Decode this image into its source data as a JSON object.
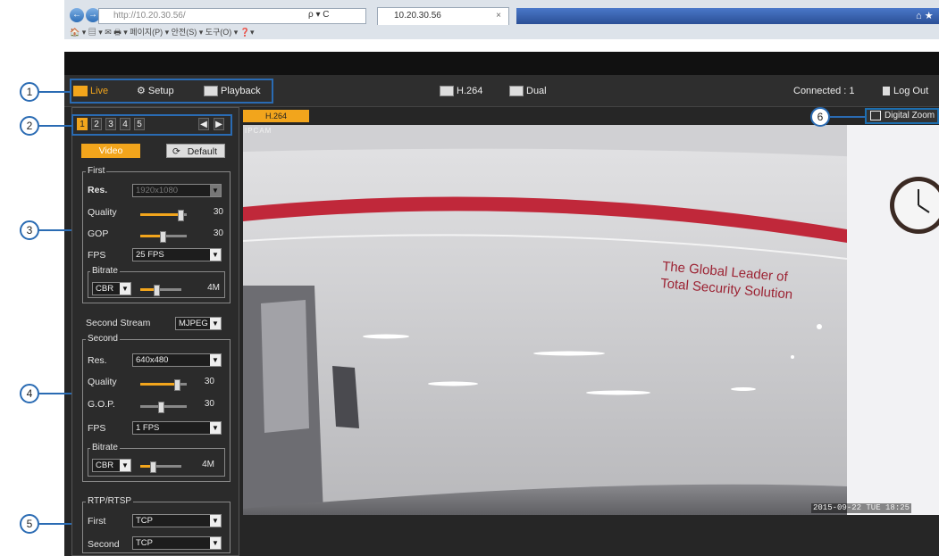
{
  "browser": {
    "back_icon": "back-arrow-icon",
    "forward_icon": "forward-arrow-icon",
    "address": "http://10.20.30.56/",
    "address_tools": "ρ ▾ C",
    "tab_title": "10.20.30.56",
    "tab_close": "×",
    "right_icons": "⌂ ★",
    "commands": "🏠 ▾  ▤ ▾ ✉  🖶 ▾  페이지(P) ▾  안전(S) ▾  도구(O) ▾  ❓▾"
  },
  "topbar": {
    "live": "Live",
    "setup": "Setup",
    "playback": "Playback",
    "codec1": "H.264",
    "codec2": "Dual",
    "connected": "Connected : 1",
    "logout": "Log Out"
  },
  "channels": {
    "items": [
      "1",
      "2",
      "3",
      "4",
      "5"
    ],
    "prev": "◀",
    "next": "▶"
  },
  "video_settings": {
    "video_btn": "Video",
    "default_btn": "Default",
    "first": {
      "legend": "First",
      "res_label": "Res.",
      "res_value": "1920x1080",
      "quality_label": "Quality",
      "quality_value": "30",
      "gop_label": "GOP",
      "gop_value": "30",
      "fps_label": "FPS",
      "fps_value": "25 FPS",
      "bitrate_legend": "Bitrate",
      "bitrate_mode": "CBR",
      "bitrate_value": "4M"
    },
    "second_stream_label": "Second Stream",
    "second_stream_value": "MJPEG",
    "second": {
      "legend": "Second",
      "res_label": "Res.",
      "res_value": "640x480",
      "quality_label": "Quality",
      "quality_value": "30",
      "gop_label": "G.O.P.",
      "gop_value": "30",
      "fps_label": "FPS",
      "fps_value": "1 FPS",
      "bitrate_legend": "Bitrate",
      "bitrate_mode": "CBR",
      "bitrate_value": "4M"
    },
    "rtp": {
      "legend": "RTP/RTSP",
      "first_label": "First",
      "first_value": "TCP",
      "second_label": "Second",
      "second_value": "TCP"
    }
  },
  "video": {
    "tab": "H.264",
    "camera_name": "IPCAM",
    "wall_text_1": "The Global Leader of",
    "wall_text_2": "Total Security Solution",
    "timestamp": "2015-09-22 TUE 18:25",
    "digital_zoom": "Digital Zoom"
  },
  "callouts": [
    "1",
    "2",
    "3",
    "4",
    "5",
    "6"
  ],
  "colors": {
    "accent": "#f2a51c",
    "callout_blue": "#2a6bb3",
    "wall_red": "#c0283a"
  }
}
